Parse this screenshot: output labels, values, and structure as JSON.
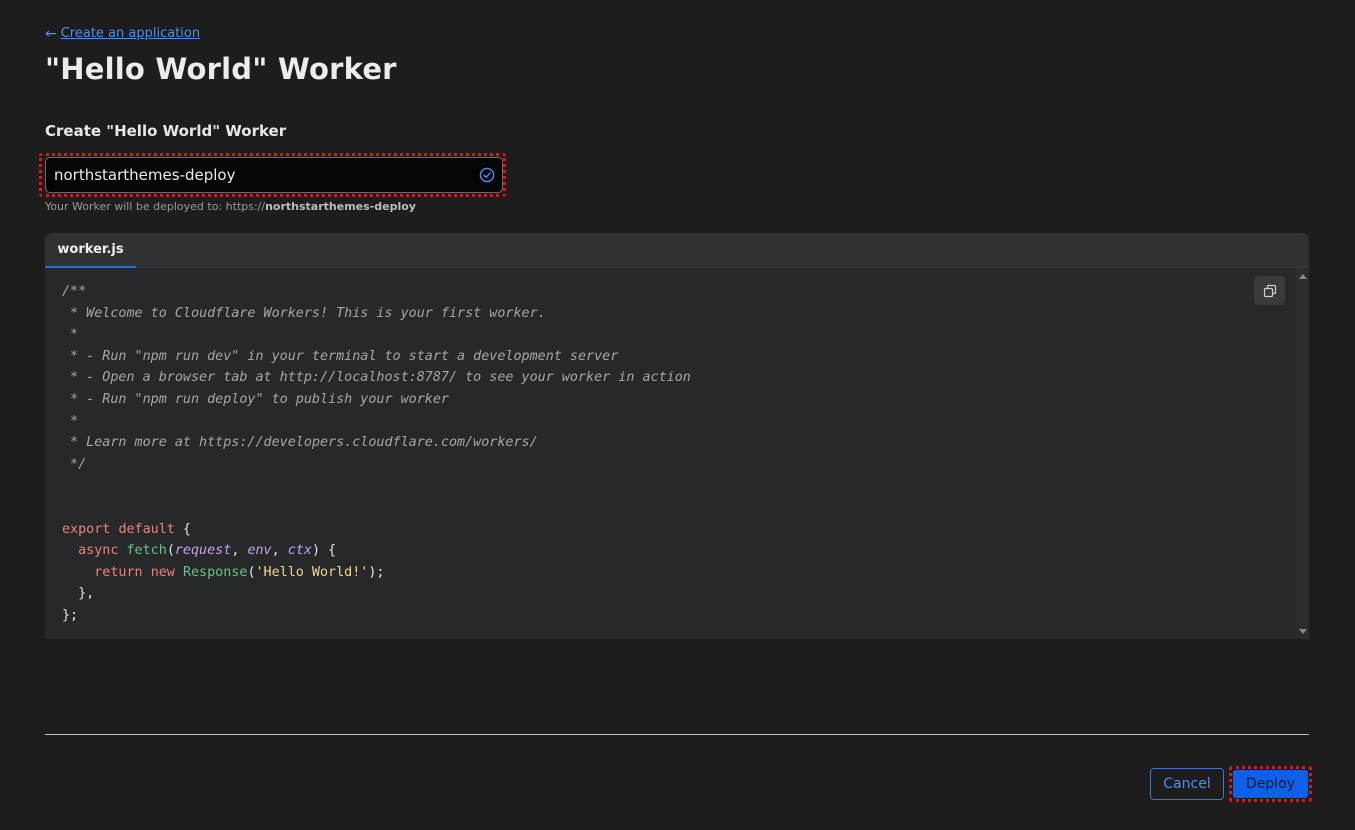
{
  "header": {
    "back_link_label": "Create an application",
    "back_icon": "arrow-left-icon",
    "title": "\"Hello World\" Worker"
  },
  "form": {
    "section_label": "Create \"Hello World\" Worker",
    "worker_name_value": "northstarthemes-deploy",
    "valid_icon": "check-circle-icon",
    "deploy_hint_prefix": "Your Worker will be deployed to: https://",
    "deploy_hint_host": "northstarthemes-deploy"
  },
  "editor": {
    "tab_label": "worker.js",
    "copy_icon": "copy-icon",
    "code_lines": [
      [
        {
          "c": "cm",
          "t": "/**"
        }
      ],
      [
        {
          "c": "cm",
          "t": " * Welcome to Cloudflare Workers! This is your first worker."
        }
      ],
      [
        {
          "c": "cm",
          "t": " *"
        }
      ],
      [
        {
          "c": "cm",
          "t": " * - Run \"npm run dev\" in your terminal to start a development server"
        }
      ],
      [
        {
          "c": "cm",
          "t": " * - Open a browser tab at http://localhost:8787/ to see your worker in action"
        }
      ],
      [
        {
          "c": "cm",
          "t": " * - Run \"npm run deploy\" to publish your worker"
        }
      ],
      [
        {
          "c": "cm",
          "t": " *"
        }
      ],
      [
        {
          "c": "cm",
          "t": " * Learn more at https://developers.cloudflare.com/workers/"
        }
      ],
      [
        {
          "c": "cm",
          "t": " */"
        }
      ],
      [],
      [],
      [
        {
          "c": "kw",
          "t": "export"
        },
        {
          "c": "pl",
          "t": " "
        },
        {
          "c": "kw",
          "t": "default"
        },
        {
          "c": "pl",
          "t": " {"
        }
      ],
      [
        {
          "c": "pl",
          "t": "  "
        },
        {
          "c": "kw",
          "t": "async"
        },
        {
          "c": "pl",
          "t": " "
        },
        {
          "c": "fn",
          "t": "fetch"
        },
        {
          "c": "pl",
          "t": "("
        },
        {
          "c": "pa",
          "t": "request"
        },
        {
          "c": "pl",
          "t": ", "
        },
        {
          "c": "pa",
          "t": "env"
        },
        {
          "c": "pl",
          "t": ", "
        },
        {
          "c": "pa",
          "t": "ctx"
        },
        {
          "c": "pl",
          "t": ") {"
        }
      ],
      [
        {
          "c": "pl",
          "t": "    "
        },
        {
          "c": "kw",
          "t": "return"
        },
        {
          "c": "pl",
          "t": " "
        },
        {
          "c": "kw",
          "t": "new"
        },
        {
          "c": "pl",
          "t": " "
        },
        {
          "c": "fn",
          "t": "Response"
        },
        {
          "c": "pl",
          "t": "("
        },
        {
          "c": "st",
          "t": "'Hello World!'"
        },
        {
          "c": "pl",
          "t": ");"
        }
      ],
      [
        {
          "c": "pl",
          "t": "  },"
        }
      ],
      [
        {
          "c": "pl",
          "t": "};"
        }
      ]
    ]
  },
  "footer": {
    "cancel_label": "Cancel",
    "deploy_label": "Deploy"
  },
  "colors": {
    "background": "#1d1d1d",
    "accent": "#0b62e9",
    "link": "#4e8ef7",
    "highlight": "#e0141b"
  }
}
